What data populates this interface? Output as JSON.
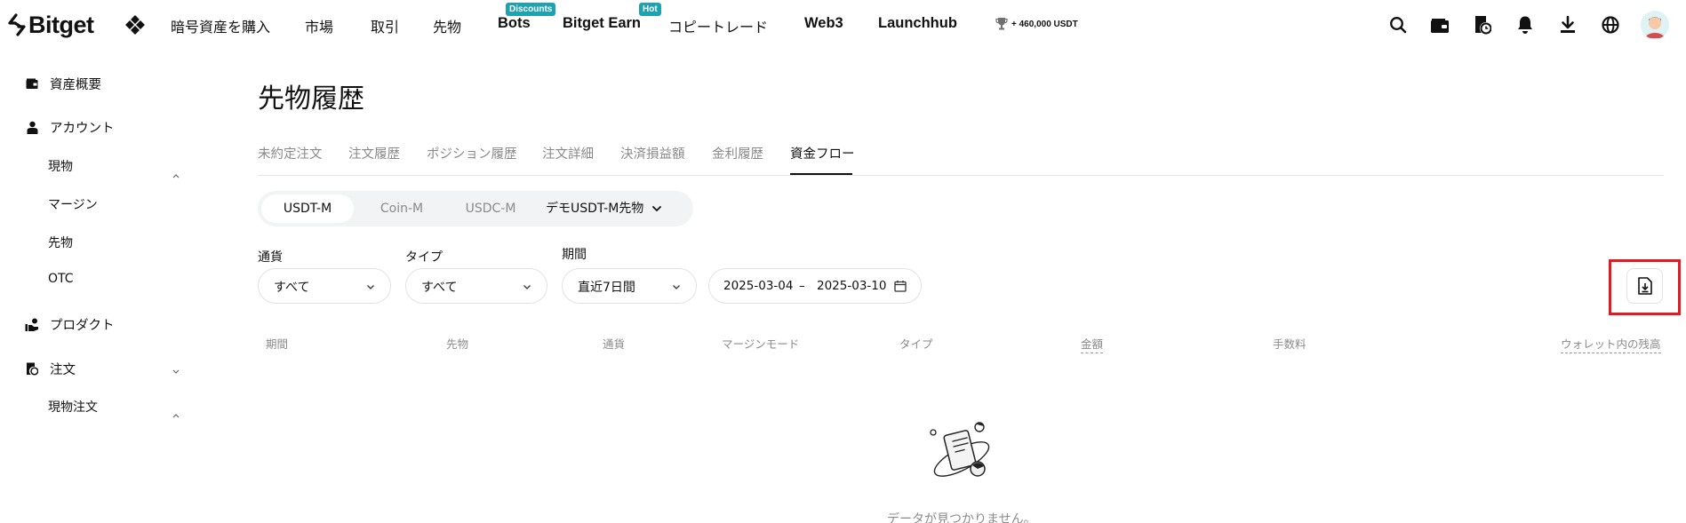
{
  "brand": {
    "name": "Bitget"
  },
  "nav": {
    "items": [
      {
        "label": "暗号資産を購入"
      },
      {
        "label": "市場"
      },
      {
        "label": "取引"
      },
      {
        "label": "先物"
      },
      {
        "label": "Bots",
        "badge": "Discounts"
      },
      {
        "label": "Bitget Earn",
        "badge": "Hot"
      },
      {
        "label": "コピートレード"
      },
      {
        "label": "Web3"
      },
      {
        "label": "Launchhub"
      }
    ],
    "promo": "+ 460,000 USDT",
    "icons": [
      "search-icon",
      "wallet-icon",
      "orders-icon",
      "bell-icon",
      "download-icon",
      "globe-icon"
    ]
  },
  "sidebar": {
    "items": [
      {
        "label": "資産概要",
        "icon": "wallet-icon"
      },
      {
        "label": "アカウント",
        "icon": "user-icon",
        "expanded": true
      },
      {
        "label": "現物"
      },
      {
        "label": "マージン"
      },
      {
        "label": "先物"
      },
      {
        "label": "OTC"
      },
      {
        "label": "プロダクト",
        "icon": "product-icon",
        "expanded": false
      },
      {
        "label": "注文",
        "icon": "orders-icon",
        "expanded": true
      },
      {
        "label": "現物注文"
      }
    ]
  },
  "page": {
    "title": "先物履歴"
  },
  "tabs": [
    {
      "label": "未約定注文",
      "active": false
    },
    {
      "label": "注文履歴",
      "active": false
    },
    {
      "label": "ポジション履歴",
      "active": false
    },
    {
      "label": "注文詳細",
      "active": false
    },
    {
      "label": "決済損益額",
      "active": false
    },
    {
      "label": "金利履歴",
      "active": false
    },
    {
      "label": "資金フロー",
      "active": true
    }
  ],
  "segments": {
    "items": [
      {
        "label": "USDT-M",
        "active": true
      },
      {
        "label": "Coin-M",
        "active": false
      },
      {
        "label": "USDC-M",
        "active": false
      }
    ],
    "demo": "デモUSDT-M先物"
  },
  "filters": {
    "currency": {
      "label": "通貨",
      "value": "すべて"
    },
    "type": {
      "label": "タイプ",
      "value": "すべて"
    },
    "period": {
      "label": "期間",
      "value": "直近7日間"
    },
    "date_from": "2025-03-04",
    "date_sep": "–",
    "date_to": "2025-03-10"
  },
  "table": {
    "columns": [
      "期間",
      "先物",
      "通貨",
      "マージンモード",
      "タイプ",
      "金額",
      "手数料",
      "ウォレット内の残高"
    ]
  },
  "empty": {
    "message": "データが見つかりません。"
  },
  "colors": {
    "accent": "#1da2b4",
    "highlight": "#e01b23",
    "muted": "#8a8a8a"
  }
}
